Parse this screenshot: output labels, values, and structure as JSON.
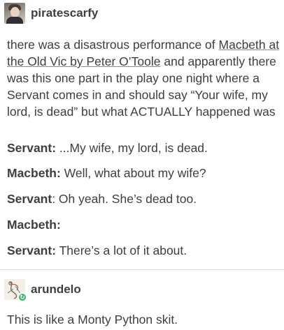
{
  "post": {
    "username": "piratescarfy",
    "intro_before_link": "there was a disastrous performance of ",
    "intro_link": "Macbeth at the Old Vic by Peter O’Toole",
    "intro_after_link": " and apparently there was this one part in the play one night where a Servant comes in and should say “Your wife, my lord, is dead” but what ACTUALLY happened was",
    "dialogue": [
      {
        "speaker": "Servant:",
        "line": " ...My wife, my lord, is dead."
      },
      {
        "speaker": "Macbeth:",
        "line": " Well, what about my wife?"
      },
      {
        "speaker": "Servant",
        "line": ": Oh yeah. She’s dead too."
      },
      {
        "speaker": "Macbeth:",
        "line": ""
      },
      {
        "speaker": "Servant:",
        "line": " There’s a lot of it about."
      }
    ]
  },
  "reply": {
    "username": "arundelo",
    "text": "This is like a Monty Python skit.",
    "badge_symbol": "↻"
  },
  "colors": {
    "badge": "#38b26c",
    "text": "#3e3e3e"
  }
}
